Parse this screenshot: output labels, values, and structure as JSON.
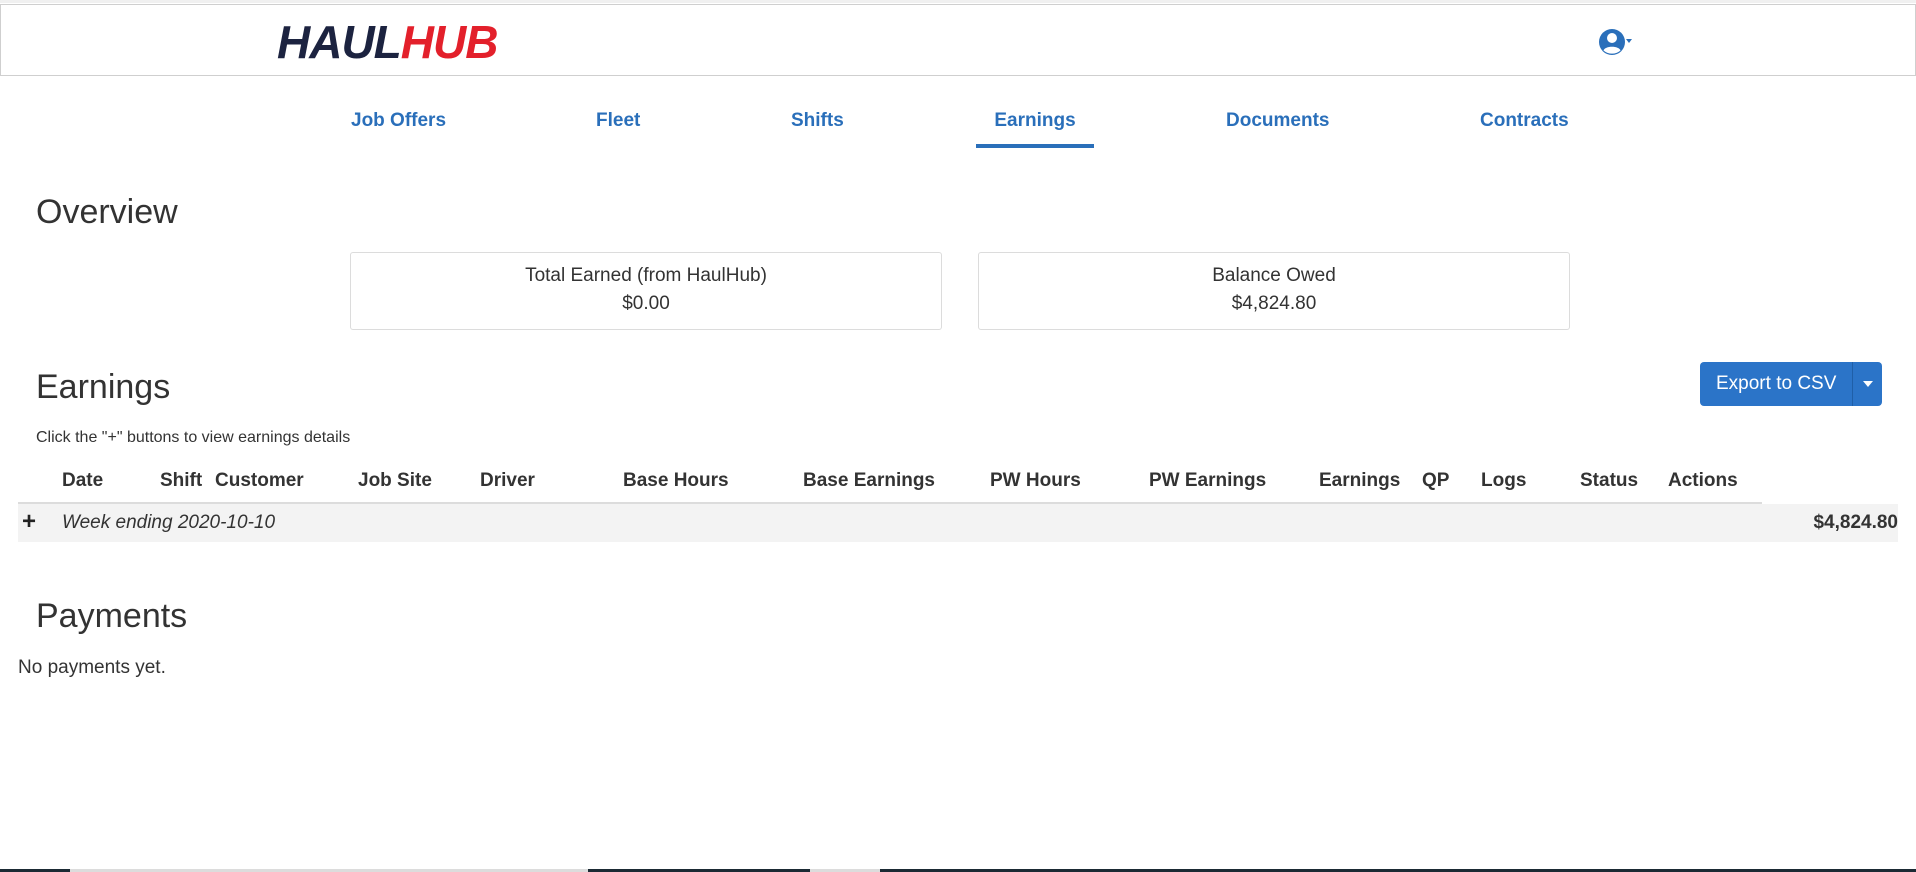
{
  "brand": {
    "part1": "HAUL",
    "part2": "HUB"
  },
  "nav": {
    "tabs": [
      {
        "label": "Job Offers"
      },
      {
        "label": "Fleet"
      },
      {
        "label": "Shifts"
      },
      {
        "label": "Earnings",
        "active": true
      },
      {
        "label": "Documents"
      },
      {
        "label": "Contracts"
      }
    ]
  },
  "overview": {
    "title": "Overview",
    "cards": [
      {
        "label": "Total Earned (from HaulHub)",
        "value": "$0.00"
      },
      {
        "label": "Balance Owed",
        "value": "$4,824.80"
      }
    ]
  },
  "earnings": {
    "title": "Earnings",
    "export_label": "Export to CSV",
    "hint": "Click the \"+\" buttons to view earnings details",
    "columns": [
      "Date",
      "Shift",
      "Customer",
      "Job Site",
      "Driver",
      "Base Hours",
      "Base Earnings",
      "PW Hours",
      "PW Earnings",
      "Earnings",
      "QP",
      "Logs",
      "Status",
      "Actions"
    ],
    "groups": [
      {
        "expand_symbol": "+",
        "label": "Week ending 2020-10-10",
        "total": "$4,824.80"
      }
    ]
  },
  "payments": {
    "title": "Payments",
    "empty_text": "No payments yet."
  },
  "icons": {
    "avatar": "user-circle-icon",
    "caret": "caret-down-icon",
    "expand": "plus-icon"
  },
  "colors": {
    "accent": "#2a6fba",
    "button": "#2b74c8",
    "brand_dark": "#1c2340",
    "brand_red": "#e3202b"
  }
}
